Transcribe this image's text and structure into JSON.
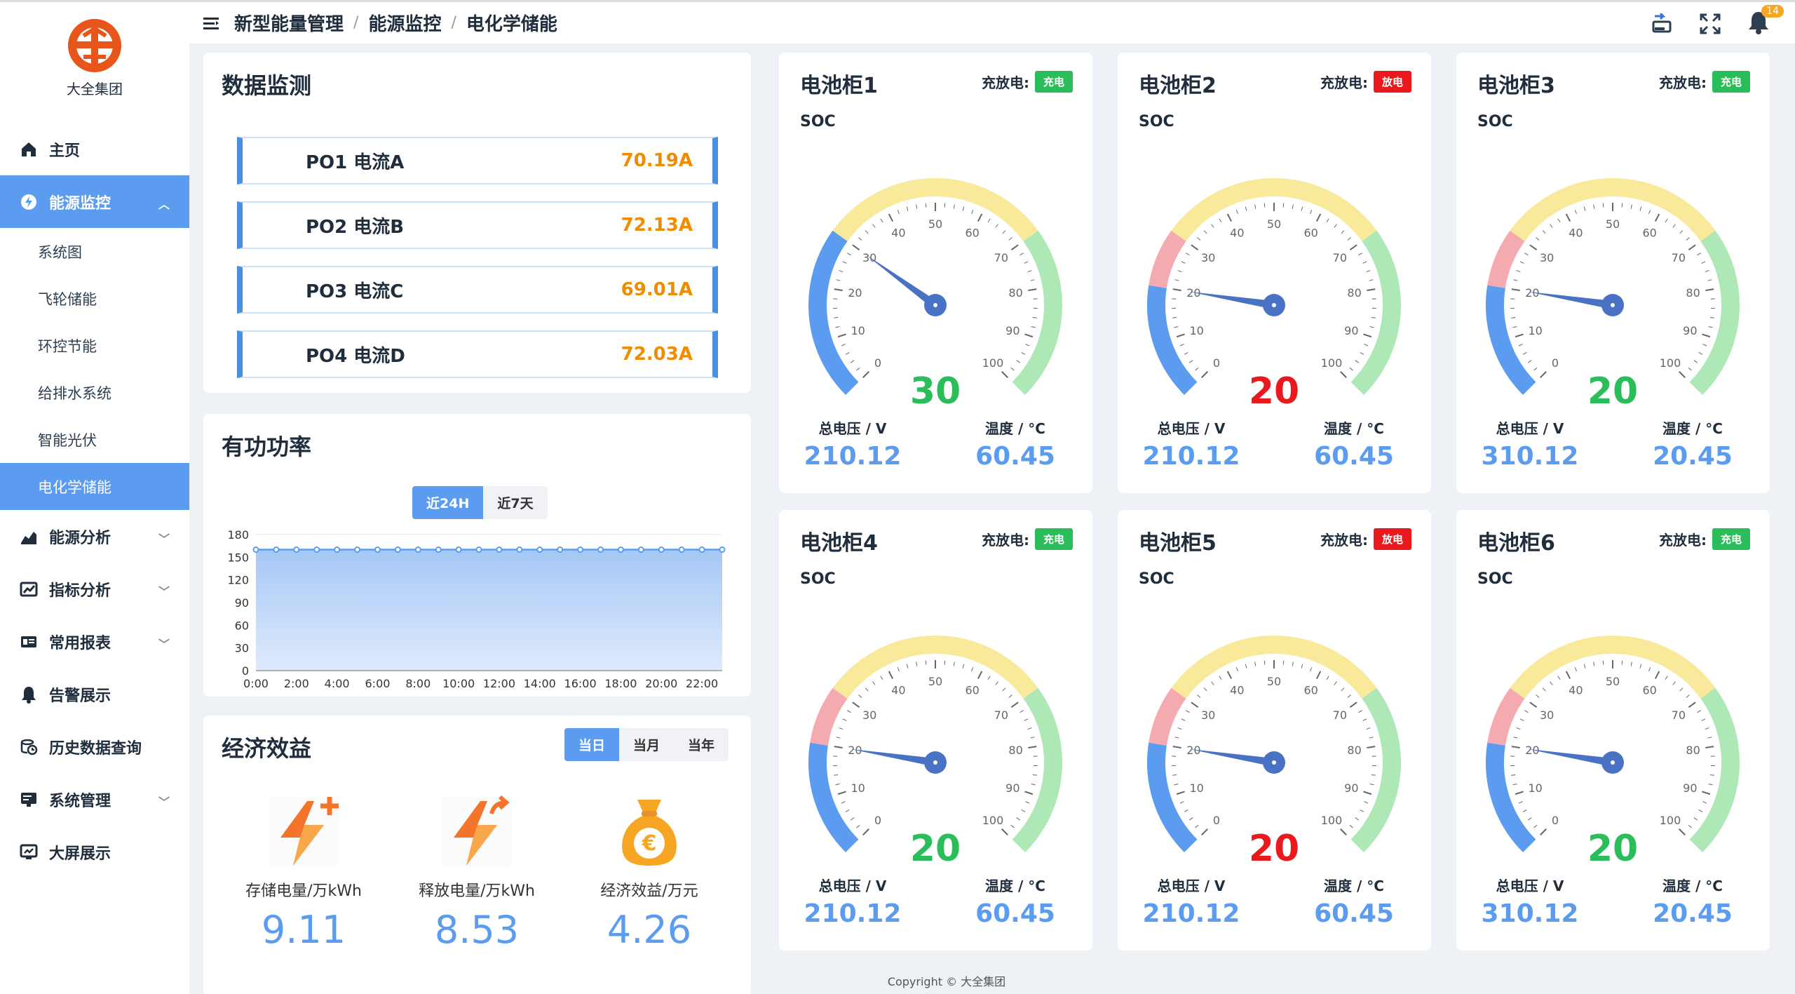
{
  "brand": {
    "name": "大全集团"
  },
  "sidebar": {
    "items": [
      {
        "label": "主页",
        "icon": "home-icon",
        "active": false
      },
      {
        "label": "能源监控",
        "icon": "energy-icon",
        "active": true,
        "expanded": true,
        "children": [
          {
            "label": "系统图",
            "active": false
          },
          {
            "label": "飞轮储能",
            "active": false
          },
          {
            "label": "环控节能",
            "active": false
          },
          {
            "label": "给排水系统",
            "active": false
          },
          {
            "label": "智能光伏",
            "active": false
          },
          {
            "label": "电化学储能",
            "active": true
          }
        ]
      },
      {
        "label": "能源分析",
        "icon": "chart-icon",
        "chevron": true
      },
      {
        "label": "指标分析",
        "icon": "trend-icon",
        "chevron": true
      },
      {
        "label": "常用报表",
        "icon": "report-icon",
        "chevron": true
      },
      {
        "label": "告警展示",
        "icon": "bell-icon"
      },
      {
        "label": "历史数据查询",
        "icon": "history-icon"
      },
      {
        "label": "系统管理",
        "icon": "settings-icon",
        "chevron": true
      },
      {
        "label": "大屏展示",
        "icon": "screen-icon"
      }
    ]
  },
  "breadcrumb": [
    "新型能量管理",
    "能源监控",
    "电化学储能"
  ],
  "header": {
    "notification_count": "14"
  },
  "monitor": {
    "title": "数据监测",
    "rows": [
      {
        "label": "PO1 电流A",
        "value": "70.19A"
      },
      {
        "label": "PO2 电流B",
        "value": "72.13A"
      },
      {
        "label": "PO3 电流C",
        "value": "69.01A"
      },
      {
        "label": "PO4 电流D",
        "value": "72.03A"
      }
    ]
  },
  "power": {
    "title": "有功功率",
    "tabs": [
      "近24H",
      "近7天"
    ],
    "active_tab": 0
  },
  "chart_data": {
    "type": "area",
    "title": "有功功率",
    "x": [
      "0:00",
      "1:00",
      "2:00",
      "3:00",
      "4:00",
      "5:00",
      "6:00",
      "7:00",
      "8:00",
      "9:00",
      "10:00",
      "11:00",
      "12:00",
      "13:00",
      "14:00",
      "15:00",
      "16:00",
      "17:00",
      "18:00",
      "19:00",
      "20:00",
      "21:00",
      "22:00",
      "23:00"
    ],
    "xticks": [
      "0:00",
      "2:00",
      "4:00",
      "6:00",
      "8:00",
      "10:00",
      "12:00",
      "14:00",
      "16:00",
      "18:00",
      "20:00",
      "22:00"
    ],
    "values": [
      160,
      160,
      160,
      160,
      160,
      160,
      160,
      160,
      160,
      160,
      160,
      160,
      160,
      160,
      160,
      160,
      160,
      160,
      160,
      160,
      160,
      160,
      160,
      160
    ],
    "ylim": [
      0,
      180
    ],
    "yticks": [
      0,
      30,
      60,
      90,
      120,
      150,
      180
    ],
    "grid": true
  },
  "econ": {
    "title": "经济效益",
    "tabs": [
      "当日",
      "当月",
      "当年"
    ],
    "active_tab": 0,
    "items": [
      {
        "label": "存储电量/万kWh",
        "value": "9.11",
        "icon": "charge-plus-icon"
      },
      {
        "label": "释放电量/万kWh",
        "value": "8.53",
        "icon": "discharge-icon"
      },
      {
        "label": "经济效益/万元",
        "value": "4.26",
        "icon": "money-bag-icon"
      }
    ]
  },
  "labels": {
    "mode": "充放电:",
    "soc": "SOC",
    "voltage": "总电压 / V",
    "temp": "温度 / °C"
  },
  "colors": {
    "accent": "#5b9cf0",
    "charge": "#2bbd5a",
    "discharge": "#e9191e",
    "orange": "#f08c00"
  },
  "cabinets": [
    {
      "name": "电池柜1",
      "status": "充电",
      "soc": 30,
      "voltage": "210.12",
      "temp": "60.45"
    },
    {
      "name": "电池柜2",
      "status": "放电",
      "soc": 20,
      "voltage": "210.12",
      "temp": "60.45"
    },
    {
      "name": "电池柜3",
      "status": "充电",
      "soc": 20,
      "voltage": "310.12",
      "temp": "20.45"
    },
    {
      "name": "电池柜4",
      "status": "充电",
      "soc": 20,
      "voltage": "210.12",
      "temp": "60.45"
    },
    {
      "name": "电池柜5",
      "status": "放电",
      "soc": 20,
      "voltage": "210.12",
      "temp": "60.45"
    },
    {
      "name": "电池柜6",
      "status": "充电",
      "soc": 20,
      "voltage": "310.12",
      "temp": "20.45"
    }
  ],
  "footer": {
    "copyright": "Copyright © 大全集团"
  }
}
